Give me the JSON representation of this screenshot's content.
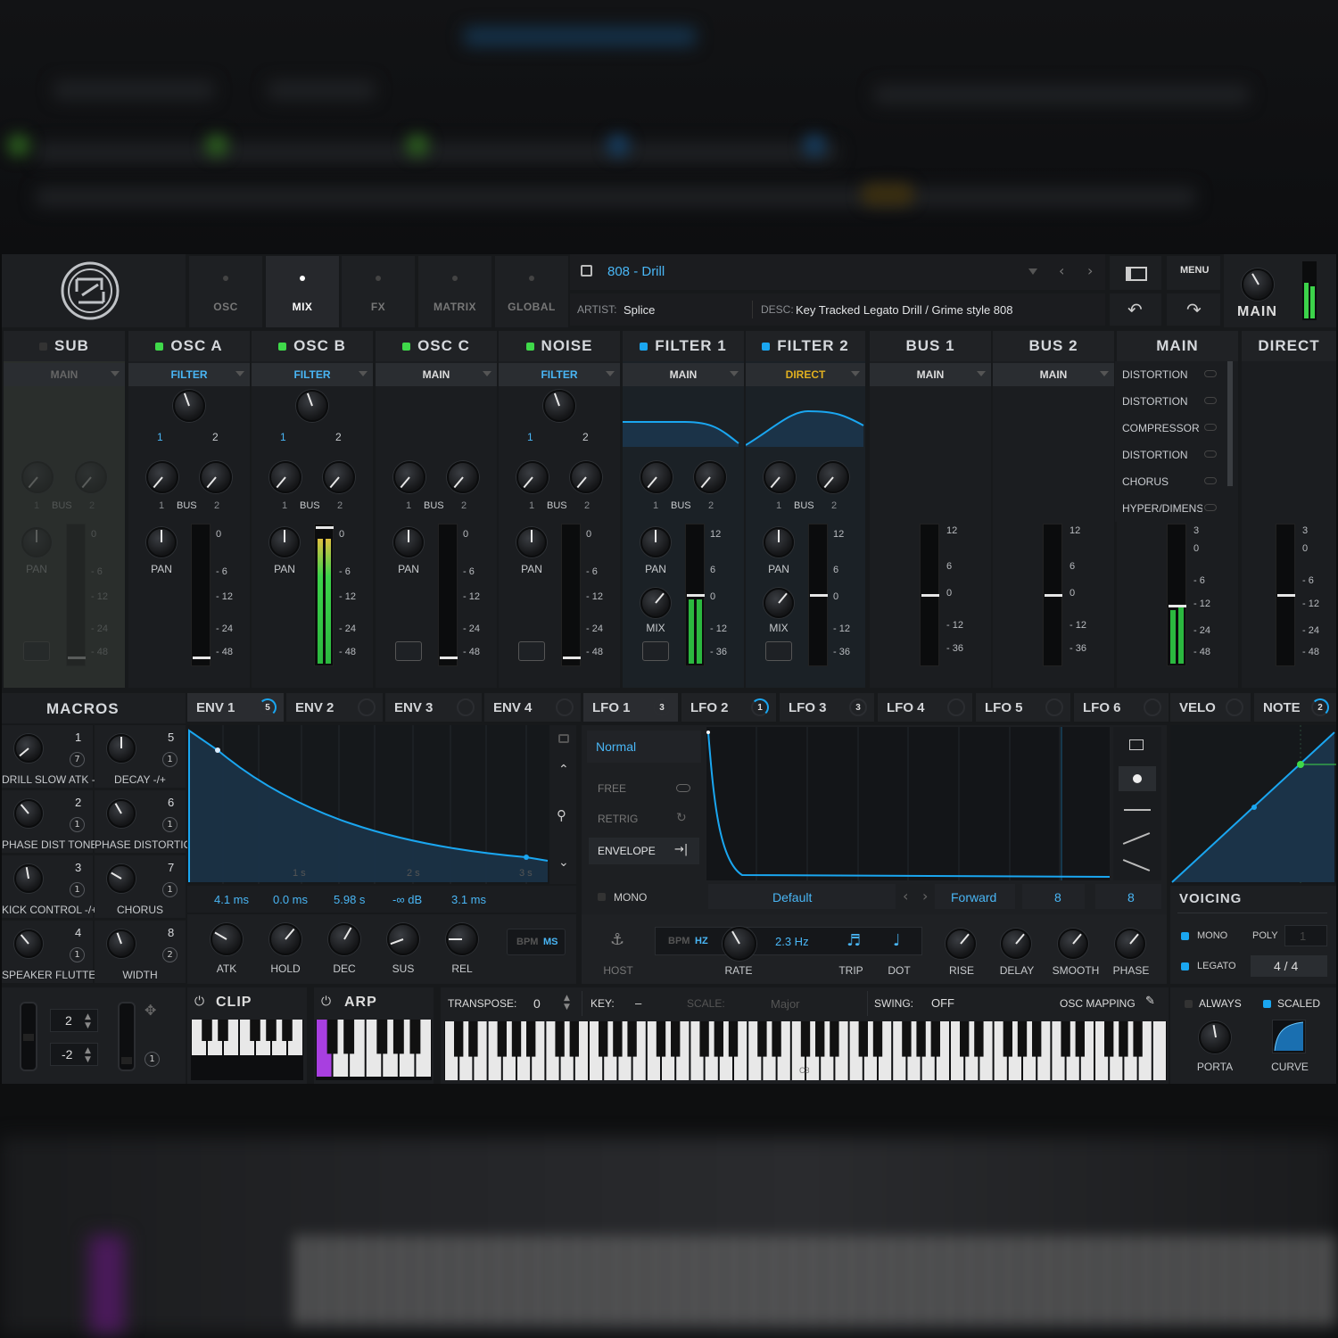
{
  "top_tabs": [
    {
      "id": "osc",
      "label": "OSC"
    },
    {
      "id": "mix",
      "label": "MIX"
    },
    {
      "id": "fx",
      "label": "FX"
    },
    {
      "id": "matrix",
      "label": "MATRIX"
    },
    {
      "id": "global",
      "label": "GLOBAL"
    }
  ],
  "preset": {
    "name": "808 - Drill",
    "artist_label": "ARTIST:",
    "artist": "Splice",
    "desc_label": "DESC:",
    "desc": "Key Tracked Legato Drill / Grime style 808"
  },
  "header_buttons": {
    "menu": "MENU",
    "main_label": "MAIN"
  },
  "channels": [
    {
      "name": "SUB",
      "route": "MAIN",
      "led": "off",
      "bus": "BUS",
      "pan": "PAN",
      "a": "1",
      "b": "2"
    },
    {
      "name": "OSC A",
      "route": "FILTER",
      "led": "green",
      "bus": "BUS",
      "pan": "PAN",
      "a": "1",
      "b": "2",
      "p1": "1",
      "p2": "2"
    },
    {
      "name": "OSC B",
      "route": "FILTER",
      "led": "green",
      "bus": "BUS",
      "pan": "PAN",
      "a": "1",
      "b": "2",
      "p1": "1",
      "p2": "2"
    },
    {
      "name": "OSC C",
      "route": "MAIN",
      "led": "green",
      "bus": "BUS",
      "pan": "PAN",
      "a": "1",
      "b": "2"
    },
    {
      "name": "NOISE",
      "route": "FILTER",
      "led": "green",
      "bus": "BUS",
      "pan": "PAN",
      "a": "1",
      "b": "2",
      "p1": "1",
      "p2": "2"
    },
    {
      "name": "FILTER 1",
      "route": "MAIN",
      "led": "blue",
      "bus": "BUS",
      "pan": "PAN",
      "mix": "MIX",
      "a": "1",
      "b": "2"
    },
    {
      "name": "FILTER 2",
      "route": "DIRECT",
      "led": "blue",
      "bus": "BUS",
      "pan": "PAN",
      "mix": "MIX",
      "a": "1",
      "b": "2"
    },
    {
      "name": "BUS 1",
      "route": "MAIN"
    },
    {
      "name": "BUS 2",
      "route": "MAIN"
    },
    {
      "name": "MAIN"
    },
    {
      "name": "DIRECT"
    }
  ],
  "meter_scale_a": [
    "0",
    "- 6",
    "- 12",
    "- 24",
    "- 48"
  ],
  "meter_scale_b": [
    "12",
    "6",
    "0",
    "- 12",
    "- 36"
  ],
  "meter_scale_c": [
    "3",
    "0",
    "- 6",
    "- 12",
    "- 24",
    "- 48"
  ],
  "fx_chain": [
    "DISTORTION",
    "DISTORTION",
    "COMPRESSOR",
    "DISTORTION",
    "CHORUS",
    "HYPER/DIMENS"
  ],
  "macros": {
    "title": "MACROS",
    "items": [
      {
        "n": "1",
        "badge": "7",
        "label": "DRILL SLOW ATK -"
      },
      {
        "n": "5",
        "badge": "1",
        "label": "DECAY -/+"
      },
      {
        "n": "2",
        "badge": "1",
        "label": "PHASE DIST TONE"
      },
      {
        "n": "6",
        "badge": "1",
        "label": "PHASE DISTORTION"
      },
      {
        "n": "3",
        "badge": "1",
        "label": "KICK CONTROL -/+"
      },
      {
        "n": "7",
        "badge": "1",
        "label": "CHORUS"
      },
      {
        "n": "4",
        "badge": "1",
        "label": "SPEAKER FLUTTER"
      },
      {
        "n": "8",
        "badge": "2",
        "label": "WIDTH"
      }
    ]
  },
  "env_tabs": [
    {
      "label": "ENV 1",
      "badge": "5"
    },
    {
      "label": "ENV 2",
      "badge": ""
    },
    {
      "label": "ENV 3",
      "badge": ""
    },
    {
      "label": "ENV 4",
      "badge": ""
    }
  ],
  "lfo_tabs": [
    {
      "label": "LFO 1",
      "badge": "3"
    },
    {
      "label": "LFO 2",
      "badge": "1"
    },
    {
      "label": "LFO 3",
      "badge": "3"
    },
    {
      "label": "LFO 4",
      "badge": ""
    },
    {
      "label": "LFO 5",
      "badge": ""
    },
    {
      "label": "LFO 6",
      "badge": ""
    }
  ],
  "mod_tabs": [
    {
      "label": "VELO",
      "badge": ""
    },
    {
      "label": "NOTE",
      "badge": "2"
    }
  ],
  "envelope": {
    "time_marks": [
      "1 s",
      "2 s",
      "3 s"
    ],
    "values": [
      "4.1 ms",
      "0.0 ms",
      "5.98 s",
      "-∞ dB",
      "3.1 ms"
    ],
    "knobs": [
      "ATK",
      "HOLD",
      "DEC",
      "SUS",
      "REL"
    ],
    "bpm": "BPM",
    "ms": "MS"
  },
  "lfo": {
    "mode": "Normal",
    "trig": [
      "FREE",
      "RETRIG",
      "ENVELOPE"
    ],
    "mono": "MONO",
    "shape": "Default",
    "direction": "Forward",
    "grid_a": "8",
    "grid_b": "8",
    "host": "HOST",
    "bpm": "BPM",
    "hz": "HZ",
    "rate_value": "2.3 Hz",
    "knobs": [
      "RATE",
      "TRIP",
      "DOT",
      "RISE",
      "DELAY",
      "SMOOTH",
      "PHASE"
    ]
  },
  "voicing": {
    "title": "VOICING",
    "mono": "MONO",
    "poly": "POLY",
    "poly_value": "1",
    "legato": "LEGATO",
    "legato_value": "4 / 4"
  },
  "bottom": {
    "oct_a": "2",
    "oct_b": "-2",
    "mw_badge": "1",
    "clip": "CLIP",
    "arp": "ARP",
    "transpose_label": "TRANSPOSE:",
    "transpose": "0",
    "key_label": "KEY:",
    "key": "–",
    "scale_label": "SCALE:",
    "scale": "Major",
    "swing_label": "SWING:",
    "swing": "OFF",
    "osc_mapping": "OSC MAPPING",
    "c3": "C3",
    "always": "ALWAYS",
    "scaled": "SCALED",
    "porta": "PORTA",
    "curve": "CURVE"
  },
  "colors": {
    "accent": "#1aa6f0",
    "green": "#3fd94a",
    "purple": "#a83fe0",
    "bg": "#17191b"
  }
}
